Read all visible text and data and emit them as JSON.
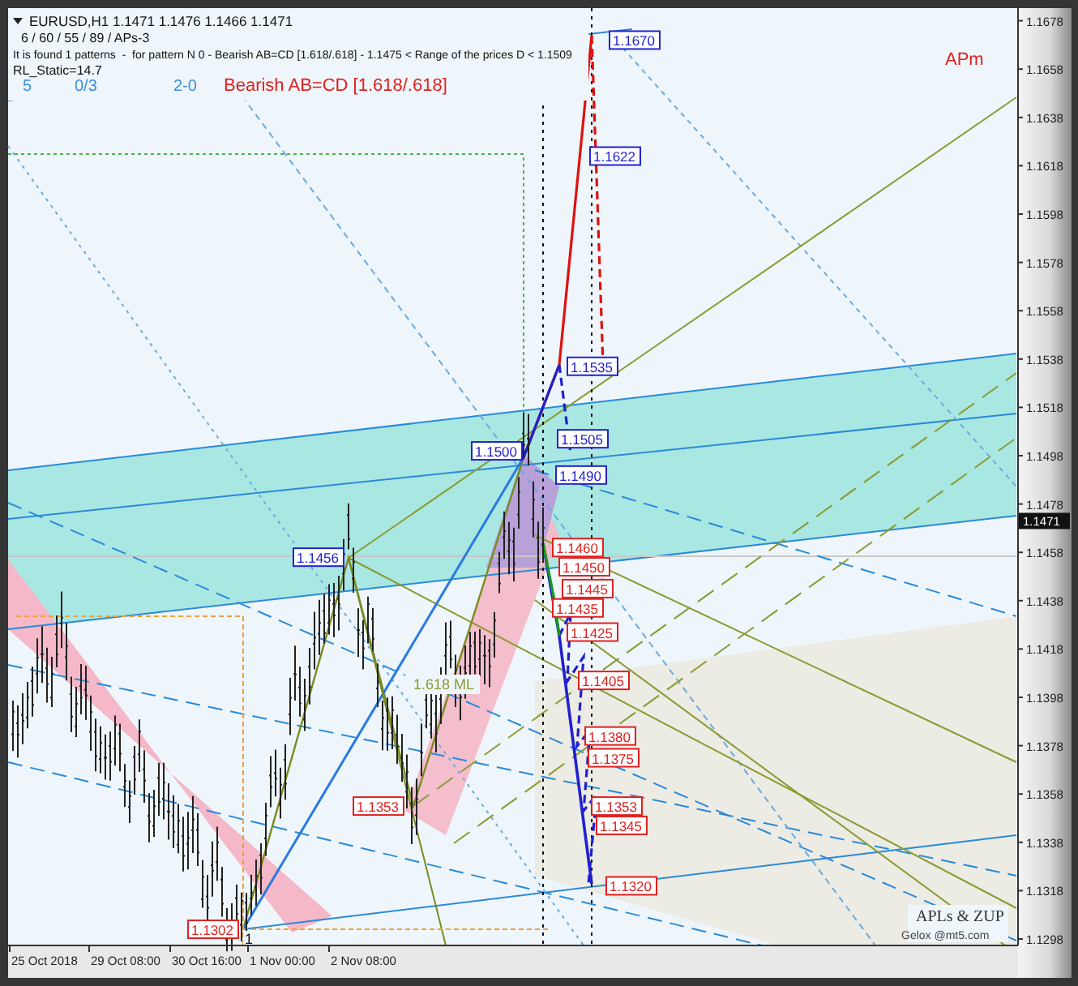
{
  "chart": {
    "symbol_line": "EURUSD,H1  1.1471 1.1476 1.1466 1.1471",
    "info_lines": [
      "6 / 60 / 55 / 89 / APs-3",
      "It is found 1 patterns  -  for pattern N 0 - Bearish AB=CD [1.618/.618] - 1.1475 < Range of the prices D < 1.1509",
      "RL_Static=14.7"
    ],
    "pattern_marks": [
      "5",
      "0/3",
      "2-0"
    ],
    "pattern_name": "Bearish AB=CD [1.618/.618]",
    "corner_tag": "APm",
    "price_labels": [
      {
        "text": "1.1670",
        "kind": "projection"
      },
      {
        "text": "1.1622",
        "kind": "projection"
      },
      {
        "text": "1.1535",
        "kind": "projection"
      },
      {
        "text": "1.1505",
        "kind": "projection"
      },
      {
        "text": "1.1490",
        "kind": "projection"
      },
      {
        "text": "1.1500",
        "kind": "projection"
      },
      {
        "text": "1.1456",
        "kind": "projection"
      },
      {
        "text": "1.1460",
        "kind": "target"
      },
      {
        "text": "1.1450",
        "kind": "target"
      },
      {
        "text": "1.1445",
        "kind": "target"
      },
      {
        "text": "1.1435",
        "kind": "target"
      },
      {
        "text": "1.1425",
        "kind": "target"
      },
      {
        "text": "1.1405",
        "kind": "target"
      },
      {
        "text": "1.1380",
        "kind": "target"
      },
      {
        "text": "1.1375",
        "kind": "target"
      },
      {
        "text": "1.1353",
        "kind": "target"
      },
      {
        "text": "1.1353",
        "kind": "target"
      },
      {
        "text": "1.1345",
        "kind": "target"
      },
      {
        "text": "1.1320",
        "kind": "target"
      },
      {
        "text": "1.1302",
        "kind": "target"
      }
    ],
    "point_number": "1",
    "median_line_label": "1.618 ML",
    "credits": [
      "APLs & ZUP",
      "Gelox @mt5.com"
    ],
    "price_axis": {
      "ticks": [
        "1.1678",
        "1.1658",
        "1.1638",
        "1.1618",
        "1.1598",
        "1.1578",
        "1.1558",
        "1.1538",
        "1.1518",
        "1.1498",
        "1.1478",
        "1.1458",
        "1.1438",
        "1.1418",
        "1.1398",
        "1.1378",
        "1.1358",
        "1.1338",
        "1.1318",
        "1.1298"
      ],
      "current": "1.1471"
    },
    "time_axis": {
      "ticks": [
        "25 Oct 2018",
        "29 Oct 08:00",
        "30 Oct 16:00",
        "1 Nov 00:00",
        "2 Nov 08:00"
      ]
    }
  }
}
